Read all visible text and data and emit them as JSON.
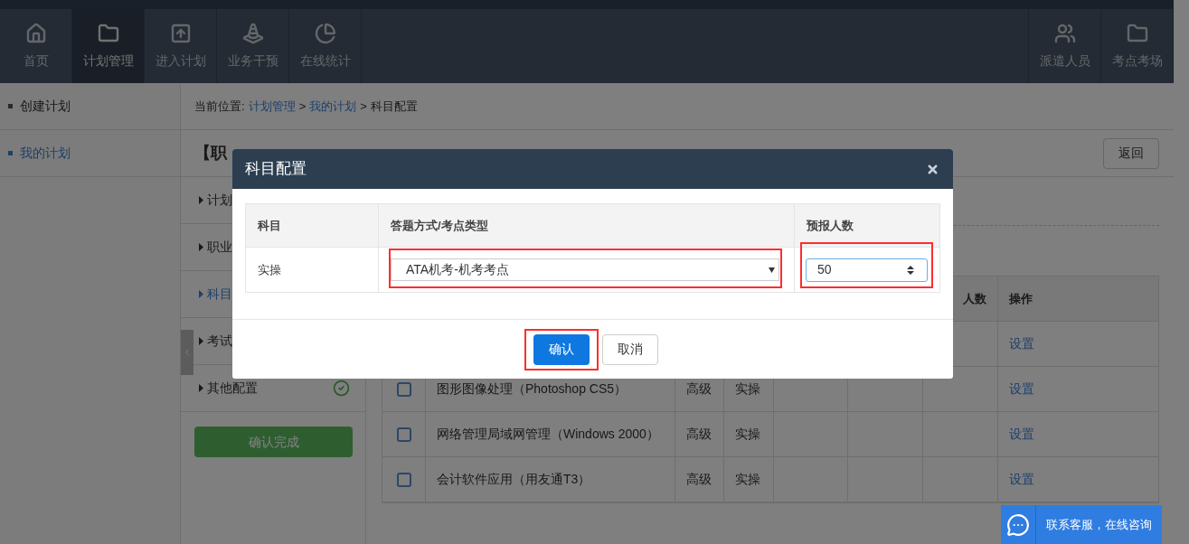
{
  "nav": {
    "left": [
      {
        "label": "首页",
        "selected": false
      },
      {
        "label": "计划管理",
        "selected": true
      },
      {
        "label": "进入计划",
        "selected": false
      },
      {
        "label": "业务干预",
        "selected": false
      },
      {
        "label": "在线统计",
        "selected": false
      }
    ],
    "right": [
      {
        "label": "派遣人员",
        "selected": false
      },
      {
        "label": "考点考场",
        "selected": false
      }
    ]
  },
  "sidebar": {
    "items": [
      {
        "label": "创建计划",
        "selected": false
      },
      {
        "label": "我的计划",
        "selected": true
      }
    ]
  },
  "breadcrumb": {
    "prefix": "当前位置:",
    "links": [
      "计划管理",
      "我的计划"
    ],
    "separator": ">",
    "current": "科目配置"
  },
  "page_title": "【职",
  "back_button": "返回",
  "steps": [
    {
      "label": "计划",
      "selected": false
    },
    {
      "label": "职业",
      "selected": false
    },
    {
      "label": "科目",
      "selected": true,
      "done": false
    },
    {
      "label": "考试",
      "selected": false
    },
    {
      "label": "其他配置",
      "selected": false,
      "done": true
    }
  ],
  "finish_button": "确认完成",
  "table": {
    "header": {
      "column_7": "人数",
      "column_8": "操作"
    },
    "rows": [
      {
        "action": "设置"
      },
      {
        "checked": false,
        "name": "图形图像处理（Photoshop CS5）",
        "level": "高级",
        "type": "实操",
        "action": "设置"
      },
      {
        "checked": false,
        "name": "网络管理局域网管理（Windows 2000）",
        "level": "高级",
        "type": "实操",
        "action": "设置"
      },
      {
        "checked": false,
        "name": "会计软件应用（用友通T3）",
        "level": "高级",
        "type": "实操",
        "action": "设置"
      }
    ]
  },
  "dialog": {
    "title": "科目配置",
    "columns": [
      "科目",
      "答题方式/考点类型",
      "预报人数"
    ],
    "row": {
      "subject": "实操",
      "mode": "ATA机考-机考考点",
      "count": "50"
    },
    "buttons": [
      {
        "label": "确认",
        "kind": "primary",
        "highlighted": true
      },
      {
        "label": "取消",
        "kind": "default",
        "highlighted": false
      }
    ],
    "highlighted_fields": {
      "mode": true,
      "count": true
    }
  },
  "chat_widget": {
    "label": "联系客服，在线咨询"
  }
}
